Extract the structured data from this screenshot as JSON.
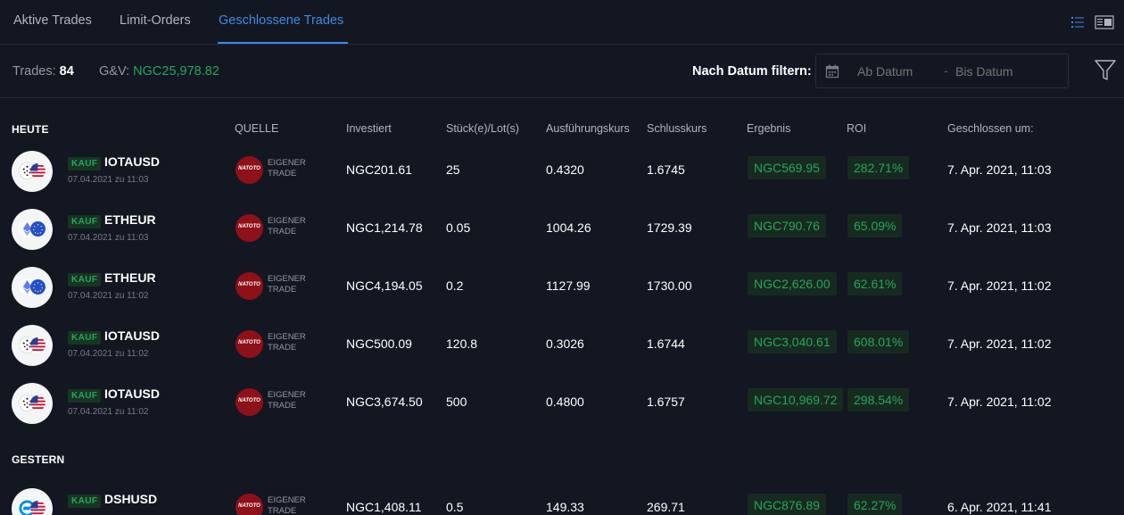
{
  "tabs": [
    {
      "label": "Aktive Trades"
    },
    {
      "label": "Limit-Orders"
    },
    {
      "label": "Geschlossene Trades"
    }
  ],
  "summary": {
    "trades_label": "Trades:",
    "trades_count": "84",
    "gv_label": "G&V:",
    "gv_value": "NGC25,978.82",
    "filter_label": "Nach Datum filtern:",
    "from_placeholder": "Ab Datum",
    "separator": "-",
    "to_placeholder": "Bis Datum"
  },
  "columns": {
    "source": "QUELLE",
    "invested": "Investiert",
    "units": "Stück(e)/Lot(s)",
    "exec_price": "Ausführungskurs",
    "close_price": "Schlusskurs",
    "result": "Ergebnis",
    "roi": "ROI",
    "closed_at": "Geschlossen um:"
  },
  "groups": [
    {
      "label": "HEUTE",
      "rows": [
        {
          "side": "KAUF",
          "symbol": "IOTAUSD",
          "opened": "07.04.2021 zu 11:03",
          "coin": "iota-icon",
          "source_logo": "NATOTO",
          "source_text": "EIGENER TRADE",
          "invested": "NGC201.61",
          "units": "25",
          "exec": "0.4320",
          "close": "1.6745",
          "result": "NGC569.95",
          "roi": "282.71%",
          "closed_at": "7. Apr. 2021, 11:03"
        },
        {
          "side": "KAUF",
          "symbol": "ETHEUR",
          "opened": "07.04.2021 zu 11:03",
          "coin": "ethereum-icon",
          "source_logo": "NATOTO",
          "source_text": "EIGENER TRADE",
          "invested": "NGC1,214.78",
          "units": "0.05",
          "exec": "1004.26",
          "close": "1729.39",
          "result": "NGC790.76",
          "roi": "65.09%",
          "closed_at": "7. Apr. 2021, 11:03"
        },
        {
          "side": "KAUF",
          "symbol": "ETHEUR",
          "opened": "07.04.2021 zu 11:02",
          "coin": "ethereum-icon",
          "source_logo": "NATOTO",
          "source_text": "EIGENER TRADE",
          "invested": "NGC4,194.05",
          "units": "0.2",
          "exec": "1127.99",
          "close": "1730.00",
          "result": "NGC2,626.00",
          "roi": "62.61%",
          "closed_at": "7. Apr. 2021, 11:02"
        },
        {
          "side": "KAUF",
          "symbol": "IOTAUSD",
          "opened": "07.04.2021 zu 11:02",
          "coin": "iota-icon",
          "source_logo": "NATOTO",
          "source_text": "EIGENER TRADE",
          "invested": "NGC500.09",
          "units": "120.8",
          "exec": "0.3026",
          "close": "1.6744",
          "result": "NGC3,040.61",
          "roi": "608.01%",
          "closed_at": "7. Apr. 2021, 11:02"
        },
        {
          "side": "KAUF",
          "symbol": "IOTAUSD",
          "opened": "07.04.2021 zu 11:02",
          "coin": "iota-icon",
          "source_logo": "NATOTO",
          "source_text": "EIGENER TRADE",
          "invested": "NGC3,674.50",
          "units": "500",
          "exec": "0.4800",
          "close": "1.6757",
          "result": "NGC10,969.72",
          "roi": "298.54%",
          "closed_at": "7. Apr. 2021, 11:02"
        }
      ]
    },
    {
      "label": "GESTERN",
      "rows": [
        {
          "side": "KAUF",
          "symbol": "DSHUSD",
          "opened": "",
          "coin": "dash-icon",
          "source_logo": "NATOTO",
          "source_text": "EIGENER TRADE",
          "invested": "NGC1,408.11",
          "units": "0.5",
          "exec": "149.33",
          "close": "269.71",
          "result": "NGC876.89",
          "roi": "62.27%",
          "closed_at": "6. Apr. 2021, 11:41"
        }
      ]
    }
  ],
  "colors": {
    "background": "#131722",
    "accent": "#3b8ae6",
    "profit": "#26a65b",
    "source_logo": "#8e1018"
  }
}
